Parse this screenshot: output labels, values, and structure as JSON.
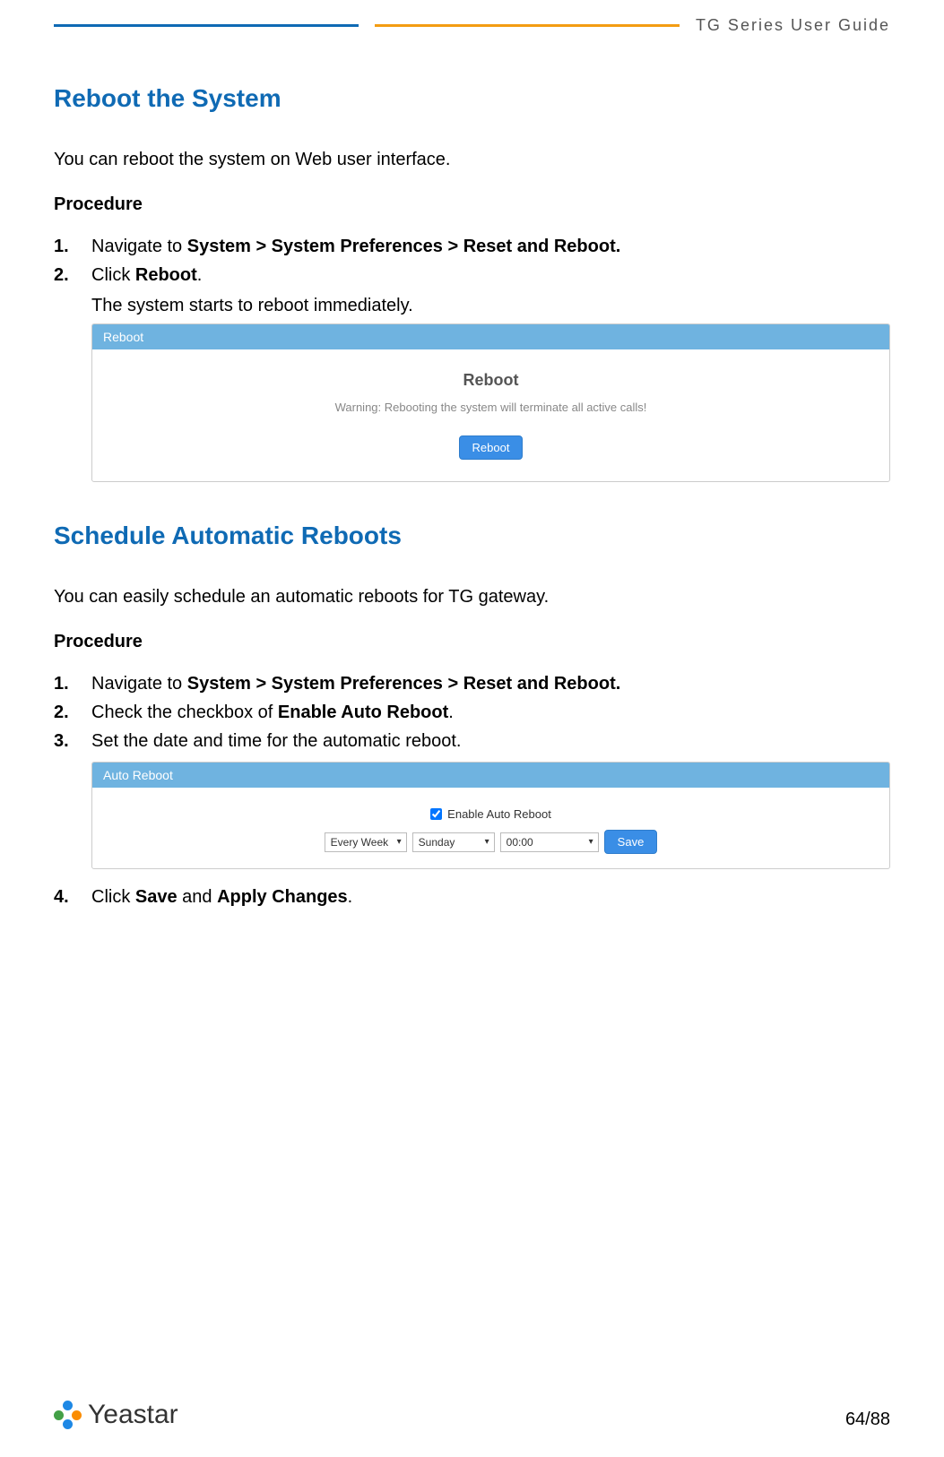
{
  "header": {
    "title": "TG  Series  User  Guide"
  },
  "section1": {
    "title": "Reboot the System",
    "intro": "You can reboot the system on Web user interface.",
    "proc_label": "Procedure",
    "steps": {
      "s1_pre": "Navigate to ",
      "s1_bold": "System > System Preferences > Reset and Reboot.",
      "s2_pre": "Click ",
      "s2_bold": "Reboot",
      "s2_post": "."
    },
    "sub": "The system starts to reboot immediately.",
    "panel": {
      "header": "Reboot",
      "title": "Reboot",
      "warning": "Warning: Rebooting the system will terminate all active calls!",
      "button": "Reboot"
    }
  },
  "section2": {
    "title": "Schedule Automatic Reboots",
    "intro": "You can easily schedule an automatic reboots for TG gateway.",
    "proc_label": "Procedure",
    "steps": {
      "s1_pre": "Navigate to ",
      "s1_bold": "System > System Preferences > Reset and Reboot.",
      "s2_pre": "Check the checkbox of ",
      "s2_bold": "Enable Auto Reboot",
      "s2_post": ".",
      "s3": "Set the date and time for the automatic reboot.",
      "s4_pre": "Click ",
      "s4_b1": "Save",
      "s4_mid": " and ",
      "s4_b2": "Apply Changes",
      "s4_post": "."
    },
    "panel": {
      "header": "Auto Reboot",
      "checkbox_label": "Enable Auto Reboot",
      "freq": "Every Week",
      "day": "Sunday",
      "time": "00:00",
      "button": "Save"
    }
  },
  "footer": {
    "brand": "Yeastar",
    "page": "64/88"
  }
}
